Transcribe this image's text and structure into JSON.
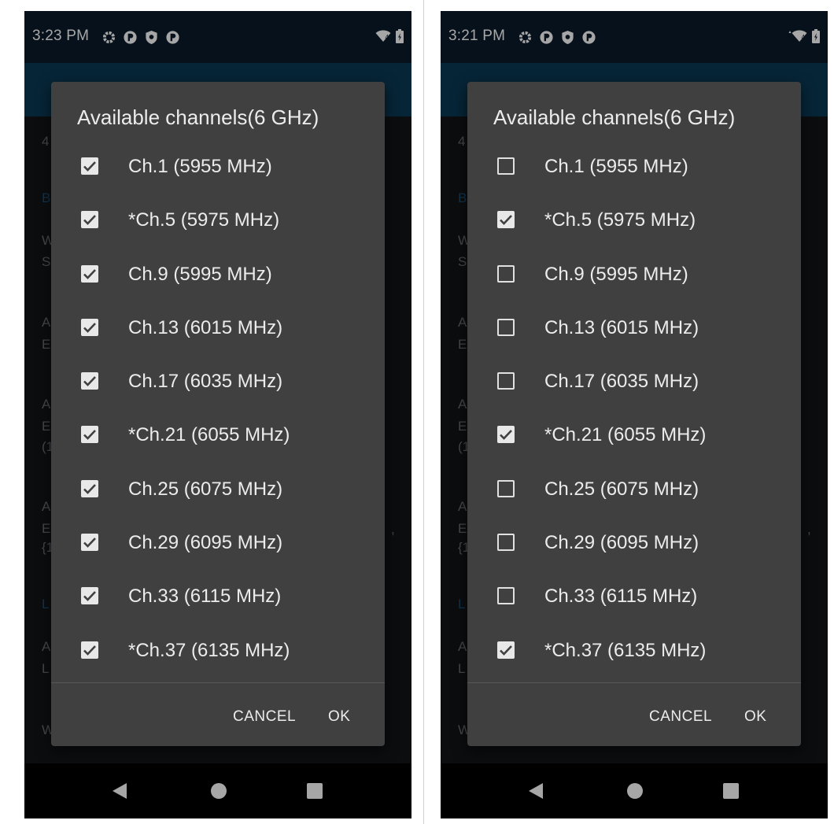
{
  "colors": {
    "status_bar": "#0b1b2c",
    "app_bar": "#0a3a55",
    "dialog": "#404040",
    "text": "#ececec"
  },
  "icons": [
    "settings-icon",
    "app-notification-icon",
    "shield-icon",
    "app-notification-icon",
    "wifi-icon",
    "battery-icon",
    "back-icon",
    "home-icon",
    "recents-icon"
  ],
  "screens": [
    {
      "status": {
        "time": "3:23 PM"
      },
      "dialog": {
        "title": "Available channels(6 GHz)",
        "items": [
          {
            "label": "Ch.1 (5955 MHz)",
            "checked": true
          },
          {
            "label": "*Ch.5 (5975 MHz)",
            "checked": true
          },
          {
            "label": "Ch.9 (5995 MHz)",
            "checked": true
          },
          {
            "label": "Ch.13 (6015 MHz)",
            "checked": true
          },
          {
            "label": "Ch.17 (6035 MHz)",
            "checked": true
          },
          {
            "label": "*Ch.21 (6055 MHz)",
            "checked": true
          },
          {
            "label": "Ch.25 (6075 MHz)",
            "checked": true
          },
          {
            "label": "Ch.29 (6095 MHz)",
            "checked": true
          },
          {
            "label": "Ch.33 (6115 MHz)",
            "checked": true
          },
          {
            "label": "*Ch.37 (6135 MHz)",
            "checked": true
          }
        ],
        "cancel": "CANCEL",
        "ok": "OK"
      },
      "background_text": [
        "4",
        "B",
        "W",
        "S",
        "A",
        "E",
        "A",
        "E",
        "(1",
        "A",
        "E",
        "{1",
        "L",
        "A",
        "L",
        "W",
        ","
      ]
    },
    {
      "status": {
        "time": "3:21 PM"
      },
      "dialog": {
        "title": "Available channels(6 GHz)",
        "items": [
          {
            "label": "Ch.1 (5955 MHz)",
            "checked": false
          },
          {
            "label": "*Ch.5 (5975 MHz)",
            "checked": true
          },
          {
            "label": "Ch.9 (5995 MHz)",
            "checked": false
          },
          {
            "label": "Ch.13 (6015 MHz)",
            "checked": false
          },
          {
            "label": "Ch.17 (6035 MHz)",
            "checked": false
          },
          {
            "label": "*Ch.21 (6055 MHz)",
            "checked": true
          },
          {
            "label": "Ch.25 (6075 MHz)",
            "checked": false
          },
          {
            "label": "Ch.29 (6095 MHz)",
            "checked": false
          },
          {
            "label": "Ch.33 (6115 MHz)",
            "checked": false
          },
          {
            "label": "*Ch.37 (6135 MHz)",
            "checked": true
          }
        ],
        "cancel": "CANCEL",
        "ok": "OK"
      },
      "background_text": [
        "4",
        "B",
        "W",
        "S",
        "A",
        "E",
        "A",
        "E",
        "(1",
        "A",
        "E",
        "{1",
        "L",
        "A",
        "L",
        "W",
        ","
      ]
    }
  ]
}
